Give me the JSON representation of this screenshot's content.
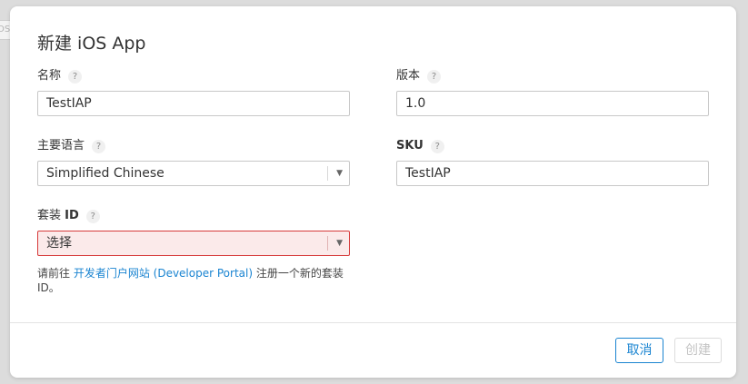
{
  "background": {
    "chip_text": "OS"
  },
  "dialog": {
    "title": "新建 iOS App",
    "help_glyph": "?",
    "fields": {
      "name": {
        "label": "名称",
        "value": "TestIAP"
      },
      "version": {
        "label": "版本",
        "value": "1.0"
      },
      "language": {
        "label": "主要语言",
        "value": "Simplified Chinese"
      },
      "sku": {
        "label": "SKU",
        "value": "TestIAP"
      },
      "bundle_id": {
        "label_prefix": "套装 ",
        "label_bold": "ID",
        "value": "选择"
      }
    },
    "hint": {
      "before": "请前往 ",
      "link": "开发者门户网站 (Developer Portal)",
      "after": " 注册一个新的套装 ID。"
    },
    "buttons": {
      "cancel": "取消",
      "create": "创建"
    }
  },
  "colors": {
    "accent": "#1a84d1",
    "error_border": "#d63a3a",
    "error_bg": "#fbeaea",
    "disabled_text": "#c4c4c4"
  },
  "icons": {
    "select_chevron": "chevron-down-icon",
    "help": "question-mark-icon"
  }
}
